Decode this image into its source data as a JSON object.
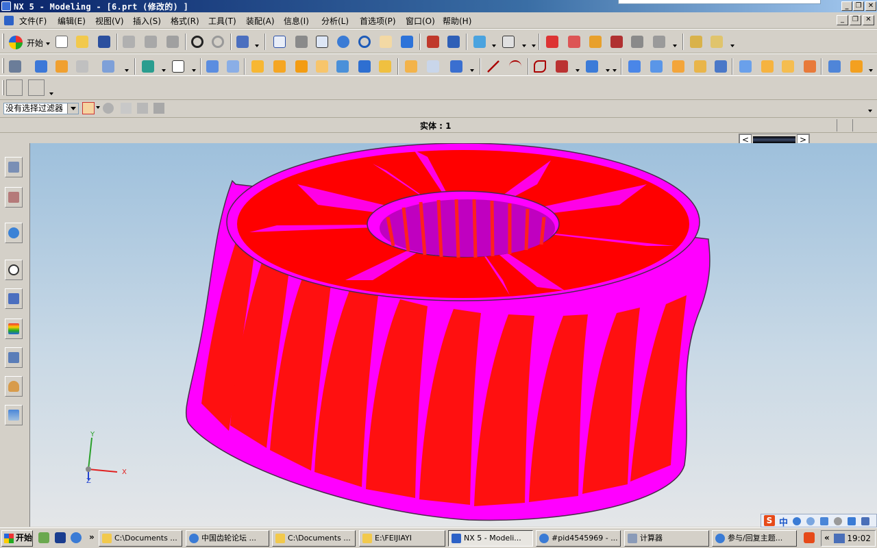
{
  "window": {
    "title": "NX 5 - Modeling - [6.prt (修改的) ]",
    "controls": [
      "_",
      "❐",
      "✕"
    ]
  },
  "menu": {
    "items": [
      "文件(F)",
      "编辑(E)",
      "视图(V)",
      "插入(S)",
      "格式(R)",
      "工具(T)",
      "装配(A)",
      "信息(I)",
      "分析(L)",
      "首选项(P)",
      "窗口(O)",
      "帮助(H)"
    ],
    "mdi_controls": [
      "_",
      "❐",
      "✕"
    ]
  },
  "toolbar": {
    "start_label": "开始",
    "more_chevron": "»"
  },
  "selection": {
    "filter_value": "没有选择过滤器"
  },
  "status": {
    "text": "实体 : 1"
  },
  "scroll": {
    "left_arrow": "<",
    "right_arrow": ">"
  },
  "axes": {
    "x": "X",
    "y": "Y",
    "z": "Z"
  },
  "ime": {
    "s": "S",
    "zh": "中"
  },
  "taskbar": {
    "start_label": "开始",
    "quicklaunch_chevron": "»",
    "tasks": [
      {
        "label": "C:\\Documents ...",
        "icon": "folder-icon",
        "active": false
      },
      {
        "label": "中国齿轮论坛 ...",
        "icon": "ie-icon",
        "active": false
      },
      {
        "label": "C:\\Documents ...",
        "icon": "folder-icon",
        "active": false
      },
      {
        "label": "E:\\FEIJIAYI",
        "icon": "folder-icon",
        "active": false
      },
      {
        "label": "NX 5 - Modeli...",
        "icon": "nx-icon",
        "active": true
      },
      {
        "label": "#pid4545969 - ...",
        "icon": "ie-icon",
        "active": false
      },
      {
        "label": "计算器",
        "icon": "calculator-icon",
        "active": false
      },
      {
        "label": "参与/回复主题...",
        "icon": "ie-icon",
        "active": false
      }
    ],
    "tray_chevron": "«",
    "clock": "19:02"
  },
  "colors": {
    "gear_face": "#ff0000",
    "gear_shade": "#ff00ff",
    "viewport_top": "#9ec0dc",
    "viewport_bottom": "#e4e6e8"
  }
}
